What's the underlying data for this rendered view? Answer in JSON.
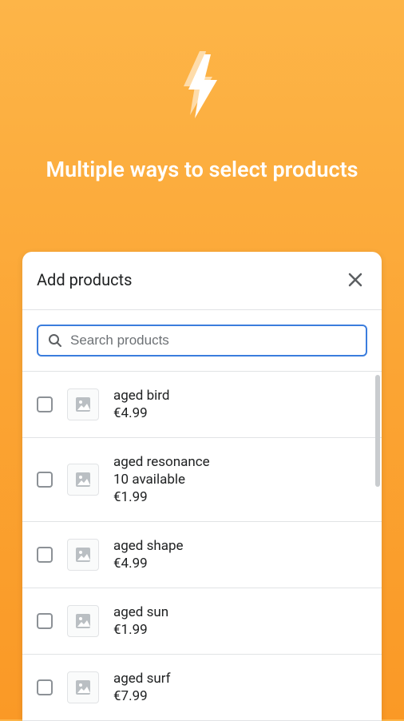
{
  "hero": {
    "title": "Multiple ways to select products"
  },
  "modal": {
    "title": "Add products",
    "search_placeholder": "Search products"
  },
  "products": [
    {
      "name": "aged bird",
      "availability": "",
      "price": "€4.99"
    },
    {
      "name": "aged resonance",
      "availability": "10 available",
      "price": "€1.99"
    },
    {
      "name": "aged shape",
      "availability": "",
      "price": "€4.99"
    },
    {
      "name": "aged sun",
      "availability": "",
      "price": "€1.99"
    },
    {
      "name": "aged surf",
      "availability": "",
      "price": "€7.99"
    }
  ]
}
